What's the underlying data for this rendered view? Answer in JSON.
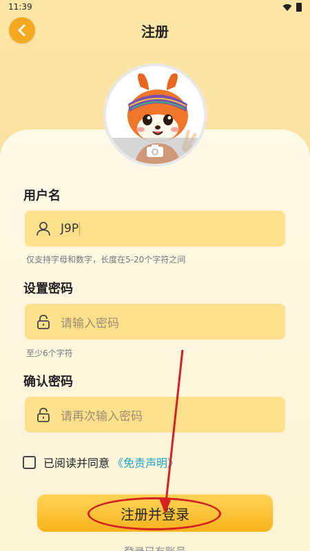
{
  "status_bar": {
    "time": "11:39",
    "icons": [
      "wifi-icon",
      "battery-icon"
    ]
  },
  "header": {
    "title": "注册",
    "back_icon": "chevron-left-icon"
  },
  "avatar": {
    "icon": "camera-icon"
  },
  "username": {
    "label": "用户名",
    "value": "J9P",
    "hint": "仅支持字母和数字，长度在5-20个字符之间",
    "icon": "user-icon"
  },
  "password": {
    "label": "设置密码",
    "placeholder": "请输入密码",
    "hint": "至少6个字符",
    "icon": "lock-icon"
  },
  "confirm_password": {
    "label": "确认密码",
    "placeholder": "请再次输入密码",
    "icon": "lock-icon"
  },
  "agreement": {
    "text": "已阅读并同意",
    "link": "《免责声明》",
    "checked": false
  },
  "submit": {
    "label": "注册并登录"
  },
  "login_link": {
    "text": "登录已有账号"
  },
  "colors": {
    "accent": "#f6a821",
    "field_bg": "#ffe08c",
    "link": "#1fa5c6",
    "annotation": "#d42020"
  }
}
